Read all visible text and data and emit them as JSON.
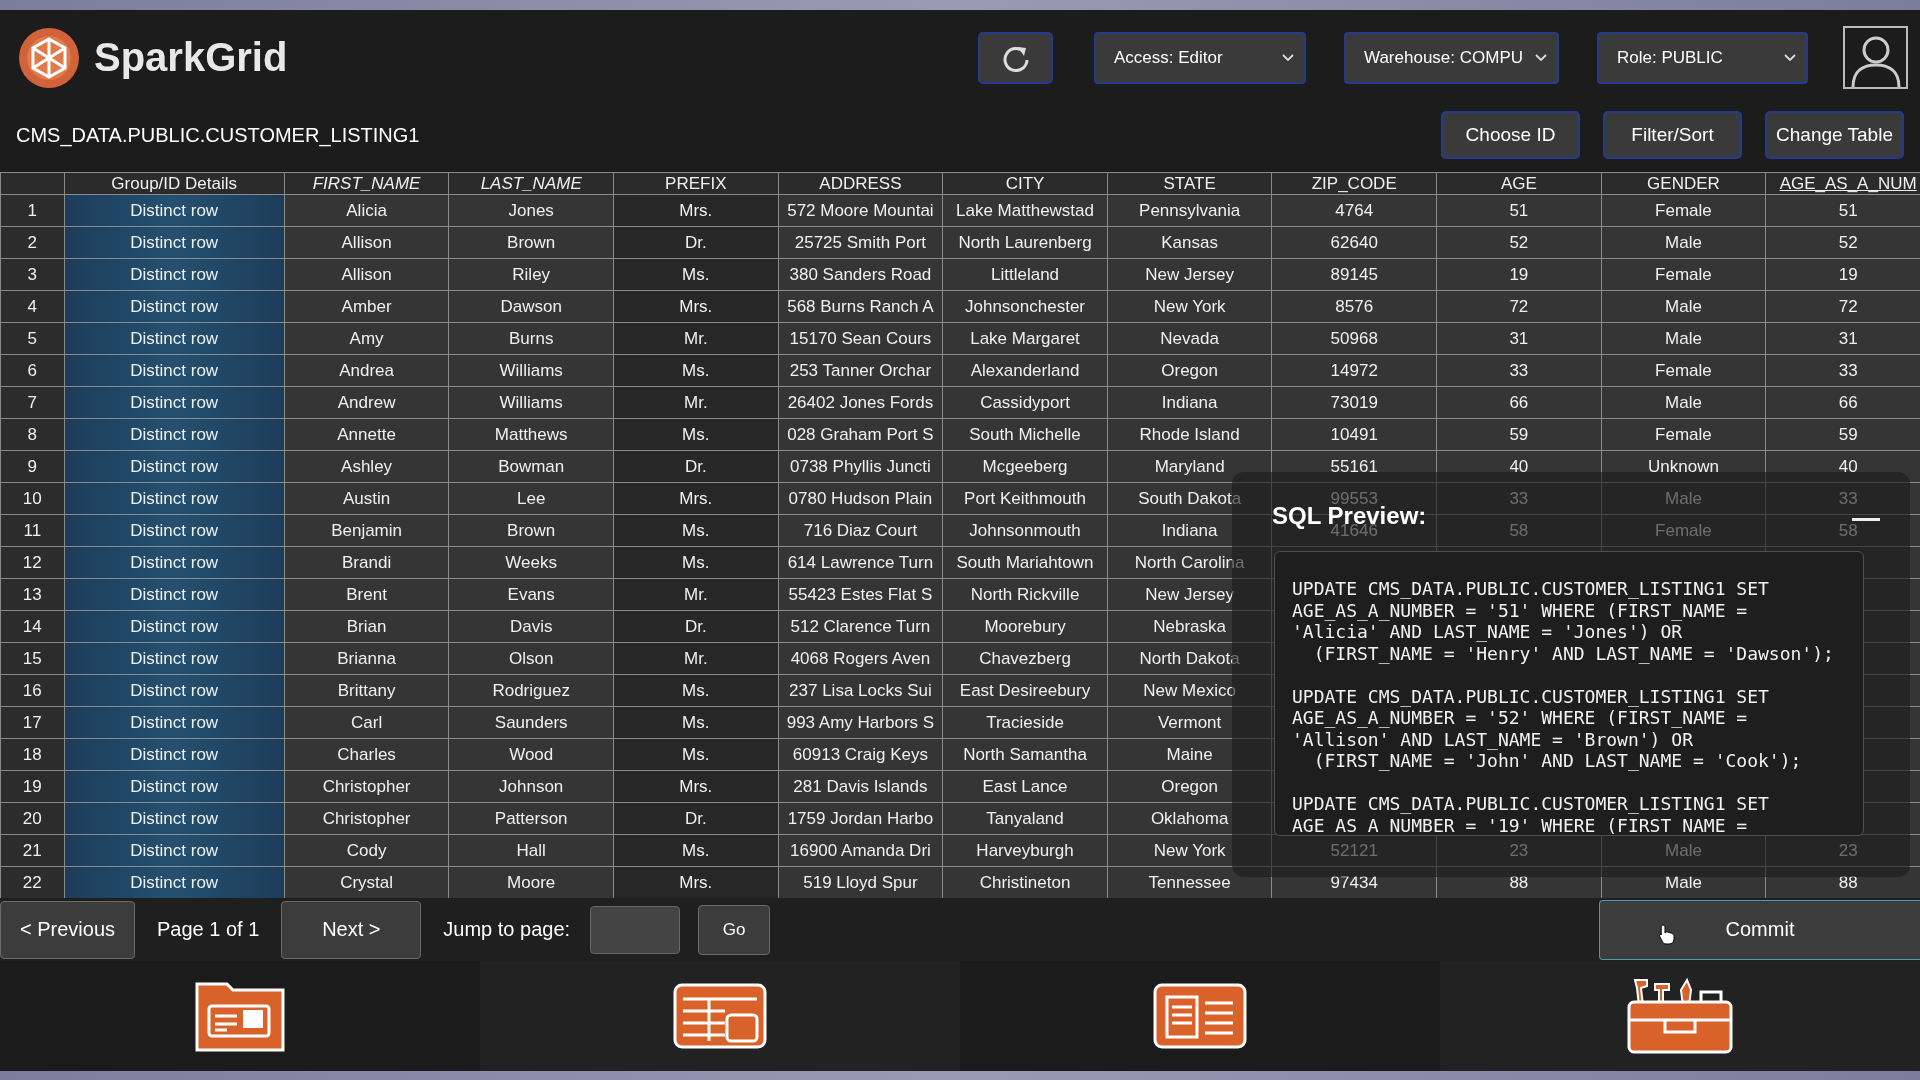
{
  "app": {
    "name": "SparkGrid"
  },
  "selects": [
    {
      "label": "Access: Editor"
    },
    {
      "label": "Warehouse: COMPU"
    },
    {
      "label": "Role: PUBLIC"
    }
  ],
  "table_name": "CMS_DATA.PUBLIC.CUSTOMER_LISTING1",
  "actions": [
    "Choose ID",
    "Filter/Sort",
    "Change Table"
  ],
  "table": {
    "columns": [
      {
        "label": "Group/ID Details",
        "kind": "plain"
      },
      {
        "label": "FIRST_NAME",
        "kind": "italic"
      },
      {
        "label": "LAST_NAME",
        "kind": "italic"
      },
      {
        "label": "PREFIX",
        "kind": "plain"
      },
      {
        "label": "ADDRESS",
        "kind": "plain"
      },
      {
        "label": "CITY",
        "kind": "plain"
      },
      {
        "label": "STATE",
        "kind": "plain"
      },
      {
        "label": "ZIP_CODE",
        "kind": "plain"
      },
      {
        "label": "AGE",
        "kind": "plain"
      },
      {
        "label": "GENDER",
        "kind": "plain"
      },
      {
        "label": "AGE_AS_A_NUM",
        "kind": "link"
      }
    ],
    "rows": [
      {
        "n": "1",
        "cells": [
          "Distinct row",
          "Alicia",
          "Jones",
          "Mrs.",
          "572 Moore Mountai",
          "Lake Matthewstad",
          "Pennsylvania",
          "4764",
          "51",
          "Female",
          "51"
        ]
      },
      {
        "n": "2",
        "cells": [
          "Distinct row",
          "Allison",
          "Brown",
          "Dr.",
          "25725 Smith Port",
          "North Laurenberg",
          "Kansas",
          "62640",
          "52",
          "Male",
          "52"
        ]
      },
      {
        "n": "3",
        "cells": [
          "Distinct row",
          "Allison",
          "Riley",
          "Ms.",
          "380 Sanders Road",
          "Littleland",
          "New Jersey",
          "89145",
          "19",
          "Female",
          "19"
        ]
      },
      {
        "n": "4",
        "cells": [
          "Distinct row",
          "Amber",
          "Dawson",
          "Mrs.",
          "568 Burns Ranch A",
          "Johnsonchester",
          "New York",
          "8576",
          "72",
          "Male",
          "72"
        ]
      },
      {
        "n": "5",
        "cells": [
          "Distinct row",
          "Amy",
          "Burns",
          "Mr.",
          "15170 Sean Cours",
          "Lake Margaret",
          "Nevada",
          "50968",
          "31",
          "Male",
          "31"
        ]
      },
      {
        "n": "6",
        "cells": [
          "Distinct row",
          "Andrea",
          "Williams",
          "Ms.",
          "253 Tanner Orchar",
          "Alexanderland",
          "Oregon",
          "14972",
          "33",
          "Female",
          "33"
        ]
      },
      {
        "n": "7",
        "cells": [
          "Distinct row",
          "Andrew",
          "Williams",
          "Mr.",
          "26402 Jones Fords",
          "Cassidyport",
          "Indiana",
          "73019",
          "66",
          "Male",
          "66"
        ]
      },
      {
        "n": "8",
        "cells": [
          "Distinct row",
          "Annette",
          "Matthews",
          "Ms.",
          "028 Graham Port S",
          "South Michelle",
          "Rhode Island",
          "10491",
          "59",
          "Female",
          "59"
        ]
      },
      {
        "n": "9",
        "cells": [
          "Distinct row",
          "Ashley",
          "Bowman",
          "Dr.",
          "0738 Phyllis Juncti",
          "Mcgeeberg",
          "Maryland",
          "55161",
          "40",
          "Unknown",
          "40"
        ]
      },
      {
        "n": "10",
        "cells": [
          "Distinct row",
          "Austin",
          "Lee",
          "Mrs.",
          "0780 Hudson Plain",
          "Port Keithmouth",
          "South Dakota",
          "99553",
          "33",
          "Male",
          "33"
        ]
      },
      {
        "n": "11",
        "cells": [
          "Distinct row",
          "Benjamin",
          "Brown",
          "Ms.",
          "716 Diaz Court",
          "Johnsonmouth",
          "Indiana",
          "41646",
          "58",
          "Female",
          "58"
        ]
      },
      {
        "n": "12",
        "cells": [
          "Distinct row",
          "Brandi",
          "Weeks",
          "Ms.",
          "614 Lawrence Turn",
          "South Mariahtown",
          "North Carolina"
        ]
      },
      {
        "n": "13",
        "cells": [
          "Distinct row",
          "Brent",
          "Evans",
          "Mr.",
          "55423 Estes Flat S",
          "North Rickville",
          "New Jersey"
        ]
      },
      {
        "n": "14",
        "cells": [
          "Distinct row",
          "Brian",
          "Davis",
          "Dr.",
          "512 Clarence Turn",
          "Moorebury",
          "Nebraska"
        ]
      },
      {
        "n": "15",
        "cells": [
          "Distinct row",
          "Brianna",
          "Olson",
          "Mr.",
          "4068 Rogers Aven",
          "Chavezberg",
          "North Dakota"
        ]
      },
      {
        "n": "16",
        "cells": [
          "Distinct row",
          "Brittany",
          "Rodriguez",
          "Ms.",
          "237 Lisa Locks Sui",
          "East Desireebury",
          "New Mexico"
        ]
      },
      {
        "n": "17",
        "cells": [
          "Distinct row",
          "Carl",
          "Saunders",
          "Ms.",
          "993 Amy Harbors S",
          "Tracieside",
          "Vermont"
        ]
      },
      {
        "n": "18",
        "cells": [
          "Distinct row",
          "Charles",
          "Wood",
          "Ms.",
          "60913 Craig Keys",
          "North Samantha",
          "Maine"
        ]
      },
      {
        "n": "19",
        "cells": [
          "Distinct row",
          "Christopher",
          "Johnson",
          "Mrs.",
          "281 Davis Islands",
          "East Lance",
          "Oregon"
        ]
      },
      {
        "n": "20",
        "cells": [
          "Distinct row",
          "Christopher",
          "Patterson",
          "Dr.",
          "1759 Jordan Harbo",
          "Tanyaland",
          "Oklahoma"
        ]
      },
      {
        "n": "21",
        "cells": [
          "Distinct row",
          "Cody",
          "Hall",
          "Ms.",
          "16900 Amanda Dri",
          "Harveyburgh",
          "New York",
          "52121",
          "23",
          "Male",
          "23"
        ]
      },
      {
        "n": "22",
        "cells": [
          "Distinct row",
          "Crystal",
          "Moore",
          "Mrs.",
          "519 Lloyd Spur",
          "Christineton",
          "Tennessee",
          "97434",
          "88",
          "Male",
          "88"
        ]
      }
    ]
  },
  "sql_preview": {
    "title": "SQL Preview:",
    "statements": [
      [
        "UPDATE CMS_DATA.PUBLIC.CUSTOMER_LISTING1 SET",
        "AGE_AS_A_NUMBER = '51' WHERE (FIRST_NAME =",
        "'Alicia' AND LAST_NAME = 'Jones') OR",
        "  (FIRST_NAME = 'Henry' AND LAST_NAME = 'Dawson');"
      ],
      [
        "UPDATE CMS_DATA.PUBLIC.CUSTOMER_LISTING1 SET",
        "AGE_AS_A_NUMBER = '52' WHERE (FIRST_NAME =",
        "'Allison' AND LAST_NAME = 'Brown') OR",
        "  (FIRST_NAME = 'John' AND LAST_NAME = 'Cook');"
      ],
      [
        "UPDATE CMS_DATA.PUBLIC.CUSTOMER_LISTING1 SET",
        "AGE_AS_A_NUMBER = '19' WHERE (FIRST_NAME ="
      ]
    ]
  },
  "pager": {
    "previous": "< Previous",
    "page": "Page 1 of 1",
    "next": "Next >",
    "jump_label": "Jump to page:",
    "go": "Go",
    "commit": "Commit"
  }
}
